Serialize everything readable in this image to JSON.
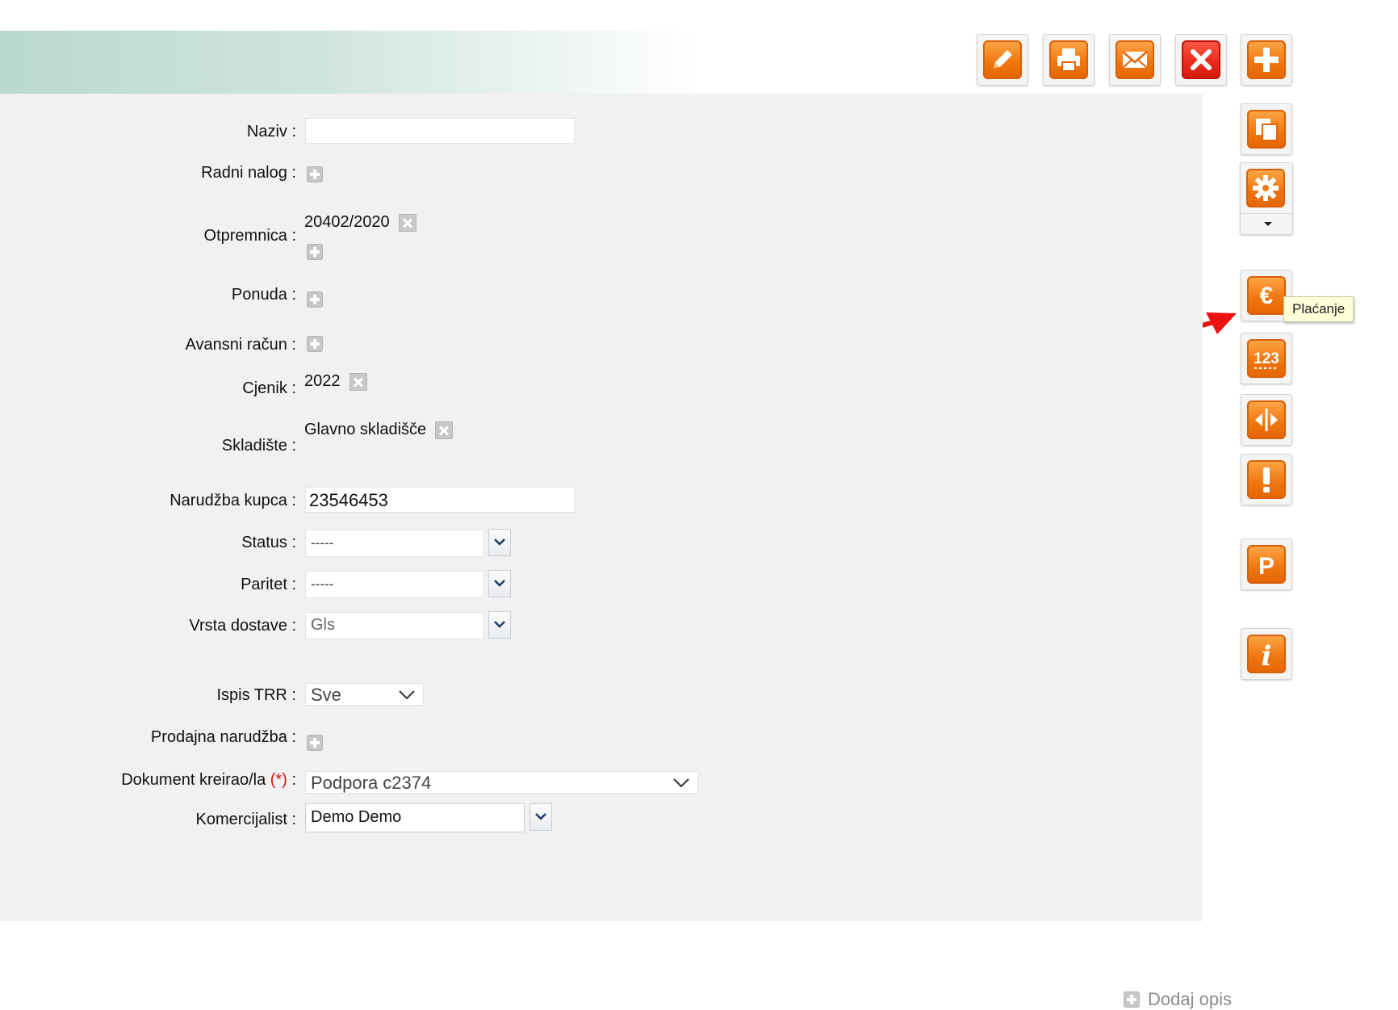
{
  "form": {
    "naziv": {
      "label": "Naziv :",
      "value": ""
    },
    "radni_nalog": {
      "label": "Radni nalog :"
    },
    "otpremnica": {
      "label": "Otpremnica :",
      "value": "20402/2020"
    },
    "ponuda": {
      "label": "Ponuda :"
    },
    "avansni_racun": {
      "label": "Avansni račun :"
    },
    "cjenik": {
      "label": "Cjenik :",
      "value": "2022"
    },
    "skladiste": {
      "label": "Skladište :",
      "value": "Glavno skladišče"
    },
    "narudzba_kupca": {
      "label": "Narudžba kupca :",
      "value": "23546453"
    },
    "status": {
      "label": "Status :",
      "value": "-----"
    },
    "paritet": {
      "label": "Paritet :",
      "value": "-----"
    },
    "vrsta_dostave": {
      "label": "Vrsta dostave :",
      "value": "Gls"
    },
    "ispis_trr": {
      "label": "Ispis TRR :",
      "value": "Sve"
    },
    "prodajna_narudzba": {
      "label": "Prodajna narudžba :"
    },
    "dokument_kreirao": {
      "label": "Dokument kreirao/la",
      "required_mark": "(*)",
      "colon": ":",
      "value": "Podpora c2374"
    },
    "komercijalist": {
      "label": "Komercijalist :",
      "value": "Demo Demo"
    }
  },
  "toolbar": {
    "buttons": [
      "edit-icon",
      "print-icon",
      "mail-icon",
      "delete-icon",
      "add-icon"
    ],
    "side_buttons": [
      "copy-icon",
      "settings-icon",
      "euro-icon",
      "numbers-icon",
      "split-icon",
      "warning-icon",
      "p-icon",
      "info-icon"
    ]
  },
  "tooltip": {
    "text": "Plaćanje"
  },
  "footer": {
    "add_description": "Dodaj opis"
  },
  "colors": {
    "accent_orange": "#f07810",
    "delete_red": "#ea2b1b",
    "arrow_red": "#ee1111",
    "panel_bg": "#f1f1f1"
  }
}
